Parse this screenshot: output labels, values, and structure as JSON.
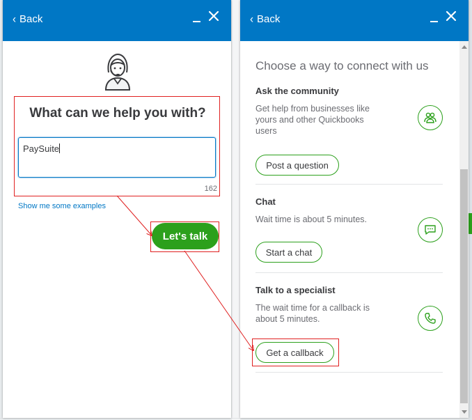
{
  "left_panel": {
    "back_label": "Back",
    "help_title": "What can we help you with?",
    "query_value": "PaySuite",
    "char_count": "162",
    "examples_link": "Show me some examples",
    "lets_talk_label": "Let's talk"
  },
  "right_panel": {
    "back_label": "Back",
    "connect_title": "Choose a way to connect with us",
    "sections": [
      {
        "title": "Ask the community",
        "description": "Get help from businesses like yours and other Quickbooks users",
        "button_label": "Post a question",
        "icon": "community-icon"
      },
      {
        "title": "Chat",
        "description": "Wait time is about 5 minutes.",
        "button_label": "Start a chat",
        "icon": "chat-icon"
      },
      {
        "title": "Talk to a specialist",
        "description": "The wait time for a callback is about 5 minutes.",
        "button_label": "Get a callback",
        "icon": "phone-icon"
      }
    ]
  },
  "colors": {
    "header_blue": "#0077c5",
    "brand_green": "#2ca01c",
    "annotation_red": "#e02020"
  }
}
